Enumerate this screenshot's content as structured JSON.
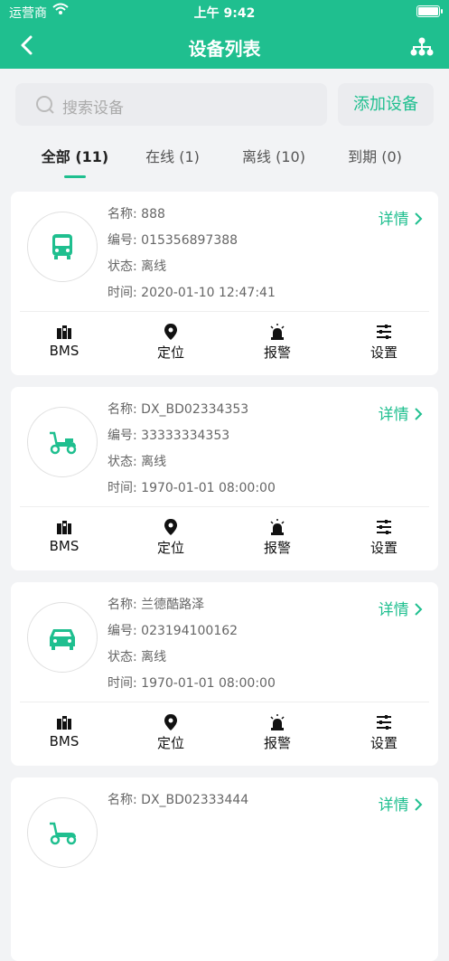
{
  "status_bar": {
    "carrier": "运营商",
    "time": "上午 9:42"
  },
  "nav": {
    "title": "设备列表"
  },
  "search": {
    "placeholder": "搜索设备",
    "add_button": "添加设备"
  },
  "tabs": [
    {
      "label": "全部 (11)",
      "active": true
    },
    {
      "label": "在线 (1)"
    },
    {
      "label": "离线 (10)"
    },
    {
      "label": "到期 (0)"
    }
  ],
  "labels": {
    "name": "名称:",
    "number": "编号:",
    "status": "状态:",
    "time": "时间:",
    "detail": "详情"
  },
  "actions": {
    "bms": "BMS",
    "locate": "定位",
    "alarm": "报警",
    "settings": "设置"
  },
  "devices": [
    {
      "icon": "bus-icon",
      "name": "888",
      "number": "015356897388",
      "status": "离线",
      "time": "2020-01-10 12:47:41"
    },
    {
      "icon": "scooter-icon",
      "name": "DX_BD02334353",
      "number": "33333334353",
      "status": "离线",
      "time": "1970-01-01 08:00:00"
    },
    {
      "icon": "car-icon",
      "name": "兰德酷路泽",
      "number": "023194100162",
      "status": "离线",
      "time": "1970-01-01 08:00:00"
    },
    {
      "icon": "scooter-icon",
      "name": "DX_BD02333444",
      "number": "",
      "status": "",
      "time": ""
    }
  ],
  "colors": {
    "accent": "#1fbf8f",
    "background": "#f2f3f5"
  }
}
